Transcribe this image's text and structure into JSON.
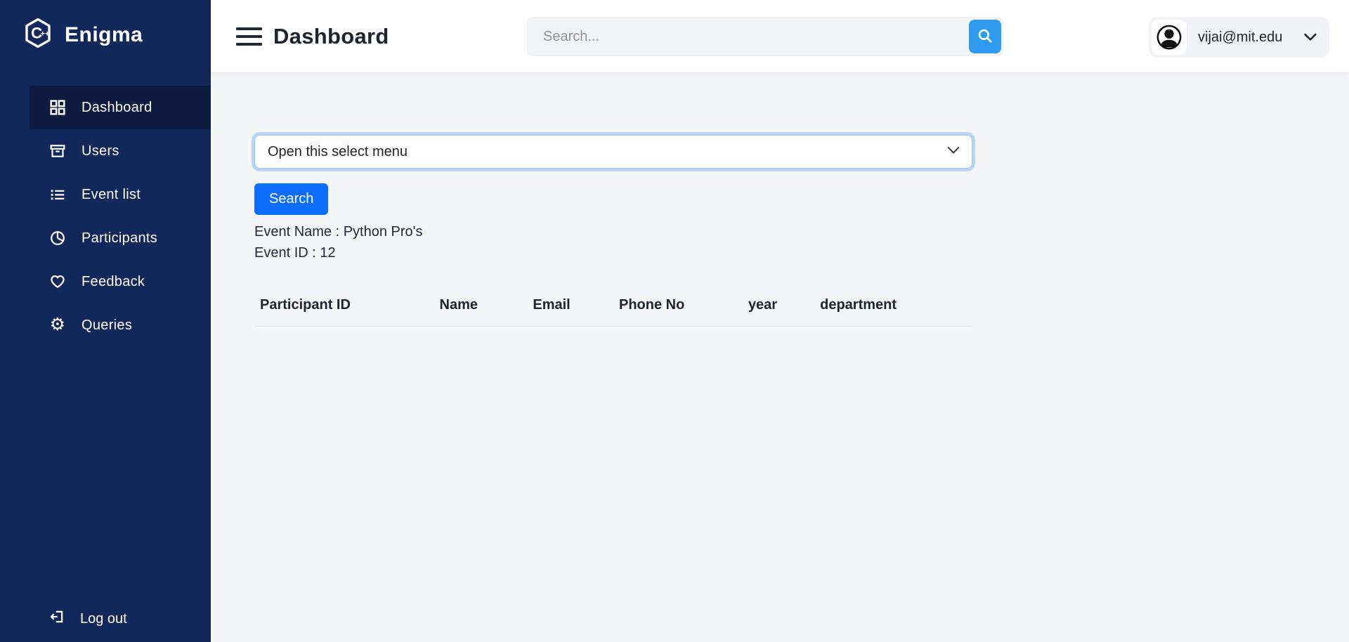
{
  "brand": {
    "name": "Enigma"
  },
  "sidebar": {
    "items": [
      {
        "label": "Dashboard",
        "icon": "grid-icon",
        "active": true
      },
      {
        "label": "Users",
        "icon": "archive-box-icon",
        "active": false
      },
      {
        "label": "Event list",
        "icon": "list-icon",
        "active": false
      },
      {
        "label": "Participants",
        "icon": "pie-chart-icon",
        "active": false
      },
      {
        "label": "Feedback",
        "icon": "heart-icon",
        "active": false
      },
      {
        "label": "Queries",
        "icon": "gear-icon",
        "active": false
      }
    ],
    "logout": {
      "label": "Log out",
      "icon": "logout-icon"
    }
  },
  "header": {
    "title": "Dashboard",
    "search": {
      "placeholder": "Search...",
      "button_icon": "search-icon"
    },
    "user": {
      "email": "vijai@mit.edu",
      "avatar_icon": "person-circle-icon"
    }
  },
  "main": {
    "event_select": {
      "selected_option": "Open this select menu"
    },
    "search_button_label": "Search",
    "event_name_line": "Event Name : Python Pro's",
    "event_id_line": "Event ID : 12",
    "participants_table": {
      "columns": [
        "Participant ID",
        "Name",
        "Email",
        "Phone No",
        "year",
        "department"
      ],
      "rows": []
    }
  },
  "colors": {
    "sidebar_bg": "#12275a",
    "sidebar_active_bg": "#0d1b41",
    "header_bg": "#ffffff",
    "content_bg": "#f4f5f7",
    "primary_button_blue": "#0d6efd",
    "header_search_button_blue": "#2e9bf0",
    "select_focus_border": "#9ec5fe",
    "text_dark": "#1d2430",
    "sidebar_text": "#ffffff"
  }
}
